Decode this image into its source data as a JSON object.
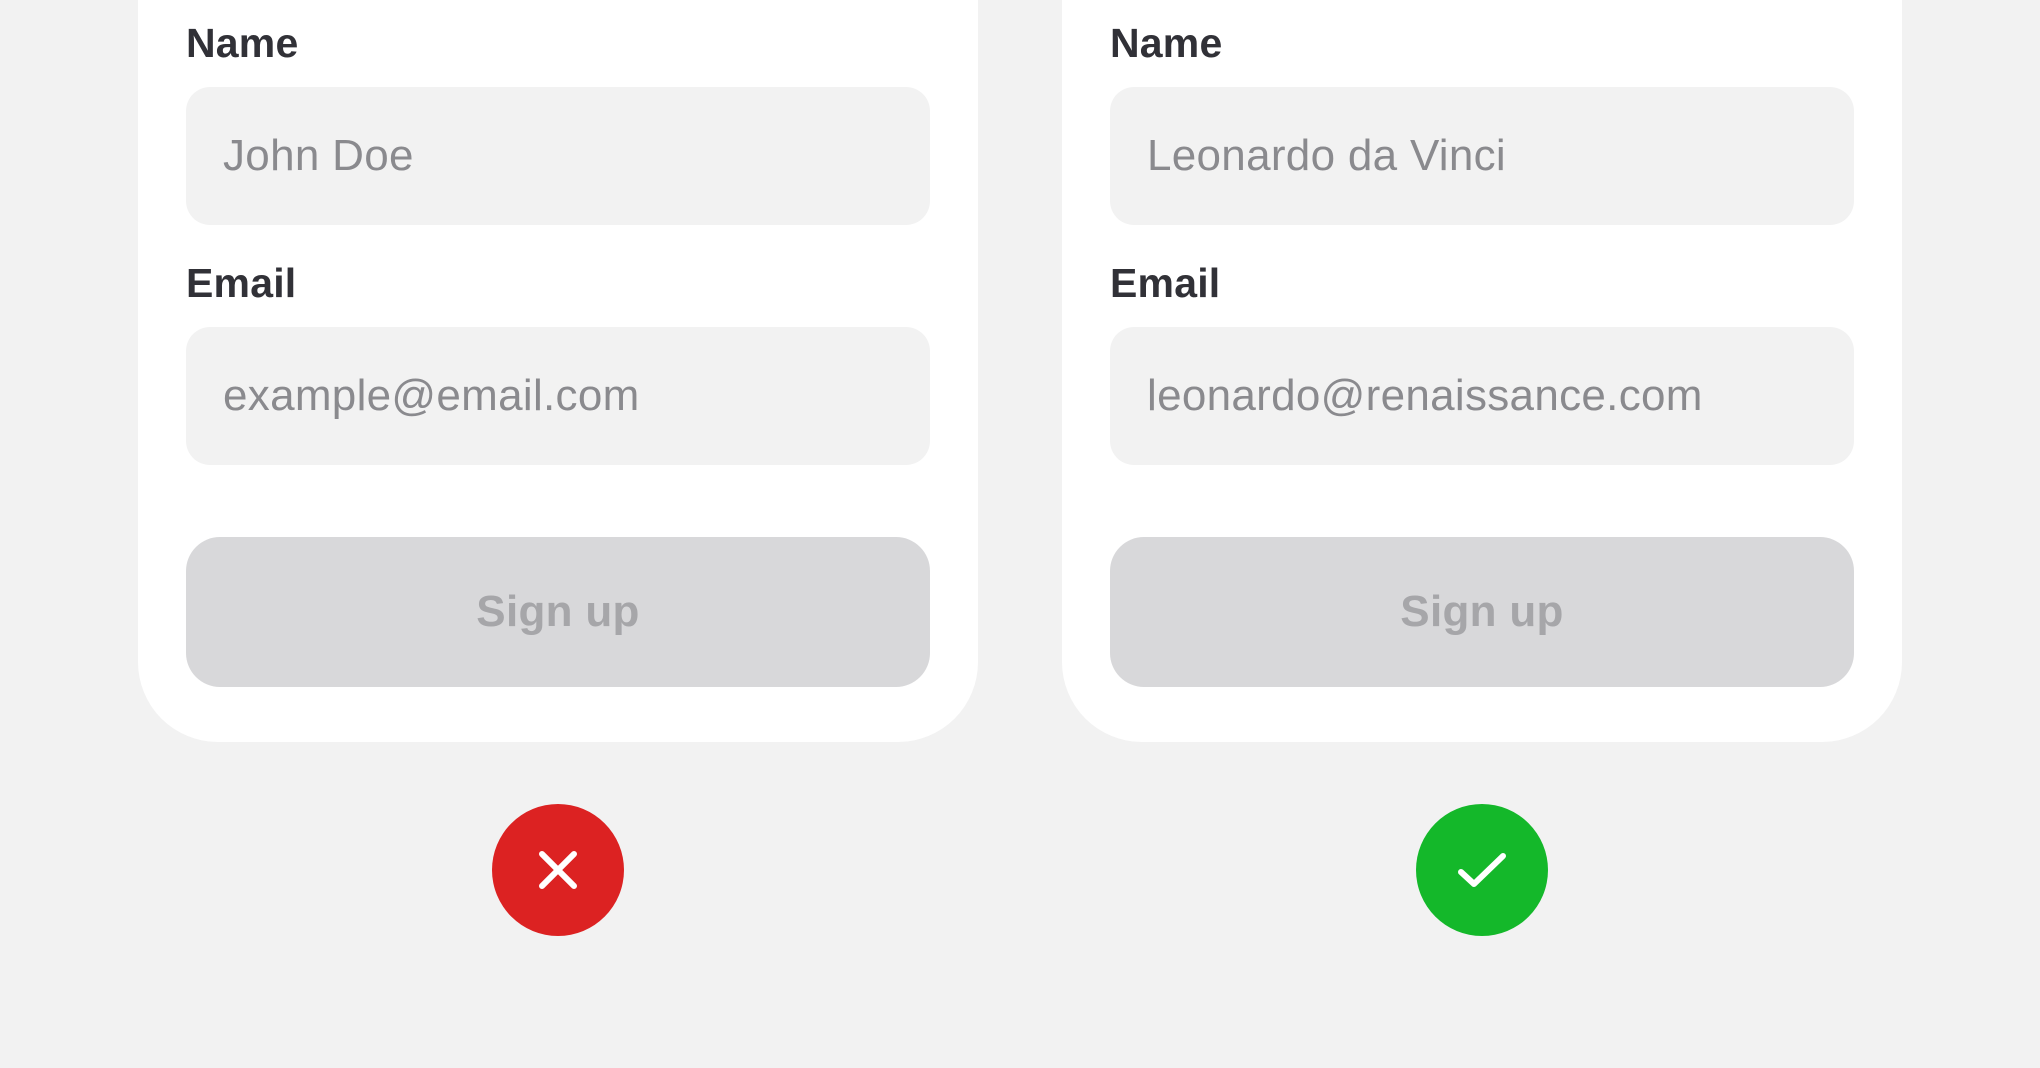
{
  "examples": {
    "bad": {
      "name_label": "Name",
      "name_value": "John Doe",
      "email_label": "Email",
      "email_value": "example@email.com",
      "button_label": "Sign up",
      "verdict_icon": "close-icon",
      "verdict_color": "#dc2222"
    },
    "good": {
      "name_label": "Name",
      "name_value": "Leonardo da Vinci",
      "email_label": "Email",
      "email_value": "leonardo@renaissance.com",
      "button_label": "Sign up",
      "verdict_icon": "check-icon",
      "verdict_color": "#14b82a"
    }
  },
  "colors": {
    "background": "#f2f2f2",
    "card": "#ffffff",
    "input_background": "#f2f2f2",
    "label_text": "#313137",
    "input_text": "#8a8a8e",
    "button_disabled_background": "#d8d8da",
    "button_disabled_text": "#a6a6a9"
  }
}
